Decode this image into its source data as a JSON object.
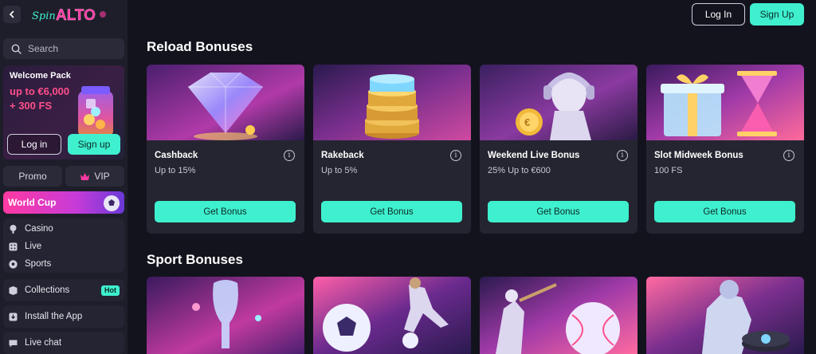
{
  "sidebar": {
    "logo": {
      "prefix": "Spin",
      "brand": "ALTO"
    },
    "search_placeholder": "Search",
    "welcome": {
      "title": "Welcome Pack",
      "amount": "up to €6,000",
      "spins": "+ 300 FS",
      "login_label": "Log in",
      "signup_label": "Sign up"
    },
    "promo_label": "Promo",
    "vip_label": "VIP",
    "worldcup_label": "World Cup",
    "nav_items": [
      {
        "label": "Casino"
      },
      {
        "label": "Live"
      },
      {
        "label": "Sports"
      }
    ],
    "collections_label": "Collections",
    "hot_badge": "Hot",
    "install_label": "Install the App",
    "livechat_label": "Live chat"
  },
  "header": {
    "login_label": "Log In",
    "signup_label": "Sign Up"
  },
  "reload_section": {
    "title": "Reload Bonuses",
    "cards": [
      {
        "title": "Cashback",
        "subtitle": "Up to 15%",
        "button": "Get Bonus"
      },
      {
        "title": "Rakeback",
        "subtitle": "Up to 5%",
        "button": "Get Bonus"
      },
      {
        "title": "Weekend Live Bonus",
        "subtitle": "25% Up to €600",
        "button": "Get Bonus"
      },
      {
        "title": "Slot Midweek Bonus",
        "subtitle": "100 FS",
        "button": "Get Bonus"
      }
    ]
  },
  "sport_section": {
    "title": "Sport Bonuses"
  },
  "colors": {
    "accent": "#3ff0cf",
    "background": "#13131d",
    "sidebar": "#1e1e2a",
    "card": "#252531",
    "promo_pink": "#ff4f8b"
  }
}
